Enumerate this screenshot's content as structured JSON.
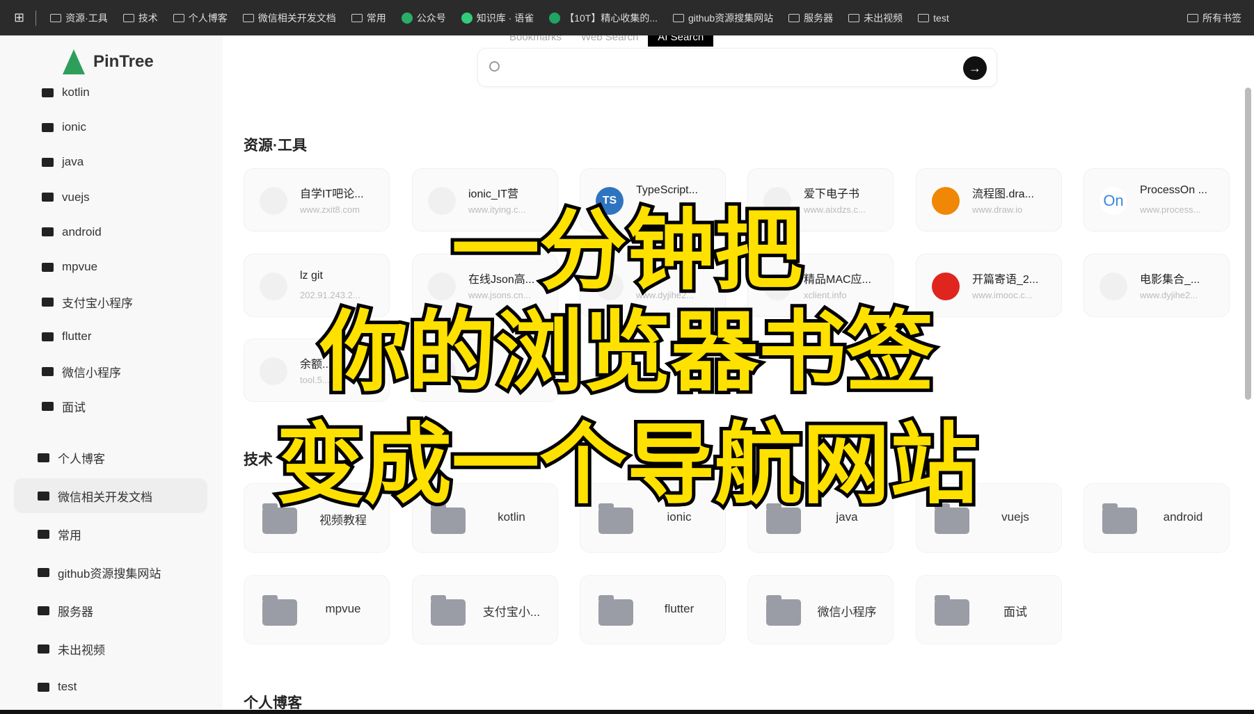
{
  "bookmarks_bar": {
    "items": [
      {
        "label": "资源·工具",
        "icon": "folder-icon"
      },
      {
        "label": "技术",
        "icon": "folder-icon"
      },
      {
        "label": "个人博客",
        "icon": "folder-icon"
      },
      {
        "label": "微信相关开发文档",
        "icon": "folder-icon"
      },
      {
        "label": "常用",
        "icon": "folder-icon"
      },
      {
        "label": "公众号",
        "icon": "wechat-icon",
        "color": "#2aae67"
      },
      {
        "label": "知识库 · 语雀",
        "icon": "yuque-icon",
        "color": "#31cc79"
      },
      {
        "label": "【10T】精心收集的...",
        "icon": "sheet-icon",
        "color": "#1fa463"
      },
      {
        "label": "github资源搜集网站",
        "icon": "folder-icon"
      },
      {
        "label": "服务器",
        "icon": "folder-icon"
      },
      {
        "label": "未出视频",
        "icon": "folder-icon"
      },
      {
        "label": "test",
        "icon": "folder-icon"
      }
    ],
    "all_bookmarks": "所有书签"
  },
  "sidebar": {
    "logo": "PinTree",
    "items": [
      {
        "label": "kotlin"
      },
      {
        "label": "ionic"
      },
      {
        "label": "java"
      },
      {
        "label": "vuejs"
      },
      {
        "label": "android"
      },
      {
        "label": "mpvue"
      },
      {
        "label": "支付宝小程序"
      },
      {
        "label": "flutter"
      },
      {
        "label": "微信小程序"
      },
      {
        "label": "面试"
      },
      {
        "label": "个人博客"
      },
      {
        "label": "微信相关开发文档",
        "active": true
      },
      {
        "label": "常用"
      },
      {
        "label": "github资源搜集网站"
      },
      {
        "label": "服务器"
      },
      {
        "label": "未出视频"
      },
      {
        "label": "test"
      }
    ]
  },
  "tabs": [
    {
      "label": "Bookmarks"
    },
    {
      "label": "Web Search"
    },
    {
      "label": "AI Search",
      "active": true
    }
  ],
  "search": {
    "value": "",
    "placeholder": ""
  },
  "sections": [
    {
      "title": "资源·工具",
      "cards": [
        {
          "name": "自学IT吧论...",
          "url": "www.zxit8.com",
          "icon": "default"
        },
        {
          "name": "ionic_IT营",
          "url": "www.itying.c...",
          "icon": "default"
        },
        {
          "name": "TypeScript...",
          "url": "",
          "icon": "TS",
          "color": "#2f74c0"
        },
        {
          "name": "爱下电子书",
          "url": "www.aixdzs.c...",
          "icon": "default"
        },
        {
          "name": "流程图.dra...",
          "url": "www.draw.io",
          "icon": "drawio",
          "color": "#f08705"
        },
        {
          "name": "ProcessOn ...",
          "url": "www.process...",
          "icon": "On",
          "color": "#3b87d8"
        },
        {
          "name": "lz git",
          "url": "202.91.243.2...",
          "icon": "default"
        },
        {
          "name": "在线Json高...",
          "url": "www.jsons.cn...",
          "icon": "default"
        },
        {
          "name": "",
          "url": "www.dyjihe2...",
          "icon": "default"
        },
        {
          "name": "精品MAC应...",
          "url": "xclient.info",
          "icon": "default"
        },
        {
          "name": "开篇寄语_2...",
          "url": "www.imooc.c...",
          "icon": "imooc",
          "color": "#e0251f"
        },
        {
          "name": "电影集合_...",
          "url": "www.dyjihe2...",
          "icon": "default"
        },
        {
          "name": "余额...",
          "url": "tool.5...",
          "icon": "default"
        },
        {
          "name": "",
          "url": "",
          "icon": "default"
        }
      ]
    },
    {
      "title": "技术",
      "folders": [
        "视频教程",
        "kotlin",
        "ionic",
        "java",
        "vuejs",
        "android",
        "mpvue",
        "支付宝小...",
        "flutter",
        "微信小程序",
        "面试"
      ]
    },
    {
      "title": "个人博客"
    }
  ],
  "overlay": {
    "lines": [
      "一分钟把",
      "你的浏览器书签",
      "变成一个导航网站"
    ],
    "color": "#ffe100"
  }
}
